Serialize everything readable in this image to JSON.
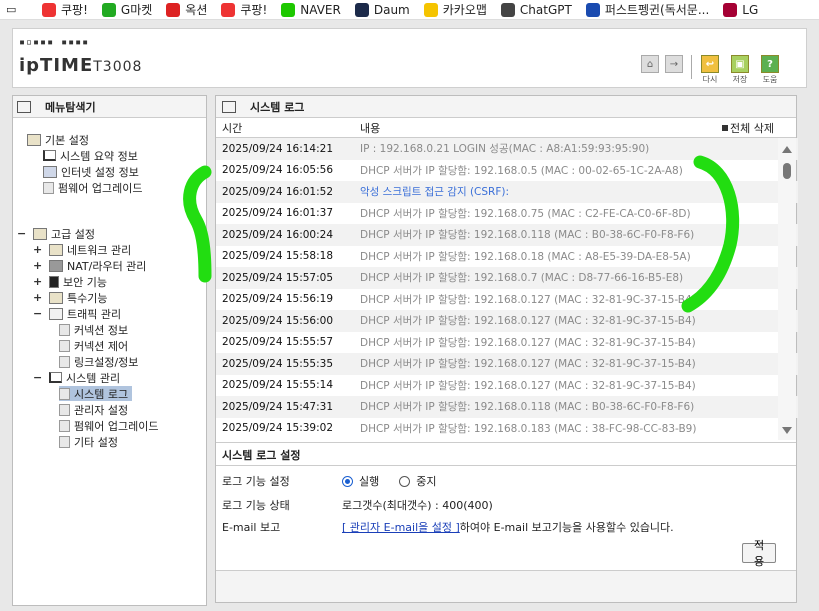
{
  "bookmarks": [
    {
      "label": "쿠팡!",
      "icon": "coupang-icon",
      "color": "#e33"
    },
    {
      "label": "G마켓",
      "icon": "gmarket-icon",
      "color": "#2a2"
    },
    {
      "label": "옥션",
      "icon": "auction-icon",
      "color": "#d22"
    },
    {
      "label": "쿠팡!",
      "icon": "coupang-icon",
      "color": "#e33"
    },
    {
      "label": "NAVER",
      "icon": "naver-icon",
      "color": "#1ec800"
    },
    {
      "label": "Daum",
      "icon": "daum-icon",
      "color": "#1c2a4a"
    },
    {
      "label": "카카오맵",
      "icon": "kakaomap-icon",
      "color": "#f5c400"
    },
    {
      "label": "ChatGPT",
      "icon": "chatgpt-icon",
      "color": "#444"
    },
    {
      "label": "퍼스트펭귄(독서문...",
      "icon": "penguin-icon",
      "color": "#1a4bb0"
    },
    {
      "label": "LG",
      "icon": "lg-icon",
      "color": "#a50034"
    }
  ],
  "header": {
    "logo_brand": "ipTIME",
    "logo_model": "T3008",
    "btn_home": "⌂",
    "btn_logout": "→",
    "btn_redo_label": "다시",
    "btn_save_label": "저장",
    "btn_help_label": "도움"
  },
  "sidebar": {
    "title": "메뉴탐색기",
    "basic": {
      "label": "기본 설정",
      "items": [
        "시스템 요약 정보",
        "인터넷 설정 정보",
        "펌웨어 업그레이드"
      ]
    },
    "advanced": {
      "label": "고급 설정",
      "items": [
        "네트워크 관리",
        "NAT/라우터 관리",
        "보안 기능",
        "특수기능",
        "트래픽 관리"
      ],
      "traffic_children": [
        "커넥션 정보",
        "커넥션 제어",
        "링크설정/정보"
      ],
      "system_label": "시스템 관리",
      "system_children": [
        "시스템 로그",
        "관리자 설정",
        "펌웨어 업그레이드",
        "기타 설정"
      ]
    }
  },
  "main": {
    "title": "시스템 로그",
    "col_time": "시간",
    "col_content": "내용",
    "delete_all": "전체 삭제",
    "logs": [
      {
        "time": "2025/09/24 16:14:21",
        "msg": "IP : 192.168.0.21 LOGIN 성공(MAC : A8:A1:59:93:95:90)",
        "blue": false
      },
      {
        "time": "2025/09/24 16:05:56",
        "msg": "DHCP 서버가 IP 할당함: 192.168.0.5 (MAC : 00-02-65-1C-2A-A8)",
        "blue": false
      },
      {
        "time": "2025/09/24 16:01:52",
        "msg": "악성 스크립트 접근 감지 (CSRF):",
        "blue": true
      },
      {
        "time": "2025/09/24 16:01:37",
        "msg": "DHCP 서버가 IP 할당함: 192.168.0.75 (MAC : C2-FE-CA-C0-6F-8D)",
        "blue": false
      },
      {
        "time": "2025/09/24 16:00:24",
        "msg": "DHCP 서버가 IP 할당함: 192.168.0.118 (MAC : B0-38-6C-F0-F8-F6)",
        "blue": false
      },
      {
        "time": "2025/09/24 15:58:18",
        "msg": "DHCP 서버가 IP 할당함: 192.168.0.18 (MAC : A8-E5-39-DA-E8-5A)",
        "blue": false
      },
      {
        "time": "2025/09/24 15:57:05",
        "msg": "DHCP 서버가 IP 할당함: 192.168.0.7 (MAC : D8-77-66-16-B5-E8)",
        "blue": false
      },
      {
        "time": "2025/09/24 15:56:19",
        "msg": "DHCP 서버가 IP 할당함: 192.168.0.127 (MAC : 32-81-9C-37-15-B4)",
        "blue": false
      },
      {
        "time": "2025/09/24 15:56:00",
        "msg": "DHCP 서버가 IP 할당함: 192.168.0.127 (MAC : 32-81-9C-37-15-B4)",
        "blue": false
      },
      {
        "time": "2025/09/24 15:55:57",
        "msg": "DHCP 서버가 IP 할당함: 192.168.0.127 (MAC : 32-81-9C-37-15-B4)",
        "blue": false
      },
      {
        "time": "2025/09/24 15:55:35",
        "msg": "DHCP 서버가 IP 할당함: 192.168.0.127 (MAC : 32-81-9C-37-15-B4)",
        "blue": false
      },
      {
        "time": "2025/09/24 15:55:14",
        "msg": "DHCP 서버가 IP 할당함: 192.168.0.127 (MAC : 32-81-9C-37-15-B4)",
        "blue": false
      },
      {
        "time": "2025/09/24 15:47:31",
        "msg": "DHCP 서버가 IP 할당함: 192.168.0.118 (MAC : B0-38-6C-F0-F8-F6)",
        "blue": false
      },
      {
        "time": "2025/09/24 15:39:02",
        "msg": "DHCP 서버가 IP 할당함: 192.168.0.183 (MAC : 38-FC-98-CC-83-B9)",
        "blue": false
      }
    ],
    "settings": {
      "title": "시스템 로그 설정",
      "log_func_label": "로그 기능 설정",
      "radio_run": "실행",
      "radio_stop": "중지",
      "radio_selected": "실행",
      "log_status_label": "로그 기능 상태",
      "log_status_value": "로그갯수(최대갯수) : 400(400)",
      "email_label": "E-mail 보고",
      "email_link": "[ 관리자 E-mail을 설정 ]",
      "email_text": "하여야 E-mail 보고기능을 사용할수 있습니다.",
      "apply": "적용"
    }
  },
  "colors": {
    "annotation": "#22dd11",
    "selected": "#b0c4de",
    "link": "#1a3fb8"
  }
}
